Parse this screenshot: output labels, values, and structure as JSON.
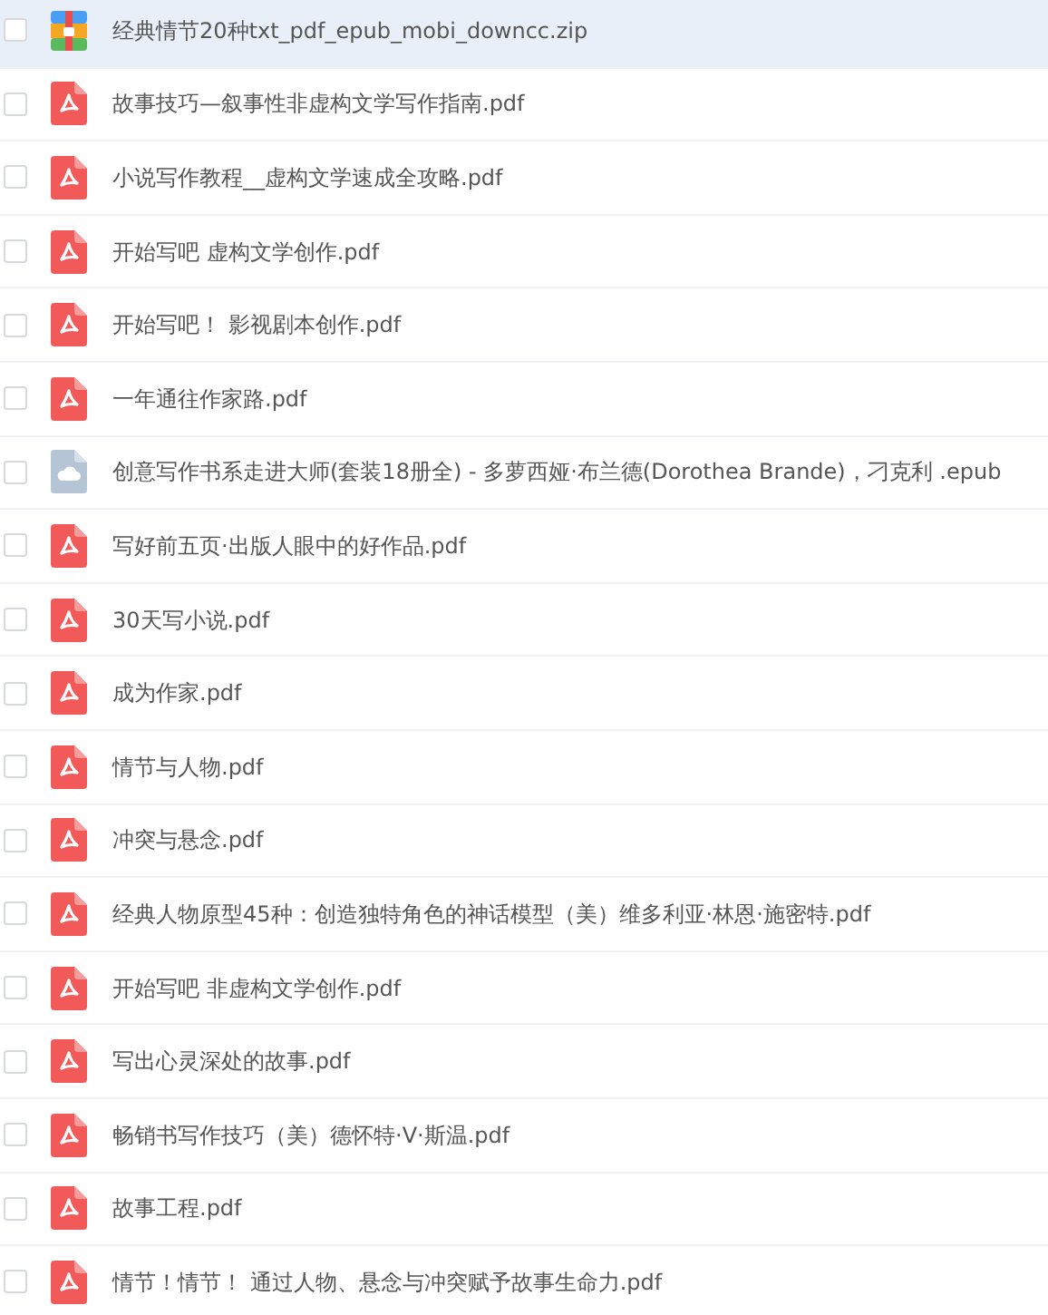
{
  "files": [
    {
      "kind": "zip",
      "name": "经典情节20种txt_pdf_epub_mobi_downcc.zip",
      "selected": true,
      "checked": false
    },
    {
      "kind": "pdf",
      "name": "故事技巧—叙事性非虚构文学写作指南.pdf",
      "selected": false,
      "checked": false
    },
    {
      "kind": "pdf",
      "name": "小说写作教程__虚构文学速成全攻略.pdf",
      "selected": false,
      "checked": false
    },
    {
      "kind": "pdf",
      "name": "开始写吧 虚构文学创作.pdf",
      "selected": false,
      "checked": false
    },
    {
      "kind": "pdf",
      "name": "开始写吧！ 影视剧本创作.pdf",
      "selected": false,
      "checked": false
    },
    {
      "kind": "pdf",
      "name": "一年通往作家路.pdf",
      "selected": false,
      "checked": false
    },
    {
      "kind": "epub",
      "name": "创意写作书系走进大师(套装18册全) - 多萝西娅·布兰德(Dorothea Brande)，刁克利 .epub",
      "selected": false,
      "checked": false
    },
    {
      "kind": "pdf",
      "name": "写好前五页·出版人眼中的好作品.pdf",
      "selected": false,
      "checked": false
    },
    {
      "kind": "pdf",
      "name": "30天写小说.pdf",
      "selected": false,
      "checked": false
    },
    {
      "kind": "pdf",
      "name": "成为作家.pdf",
      "selected": false,
      "checked": false
    },
    {
      "kind": "pdf",
      "name": "情节与人物.pdf",
      "selected": false,
      "checked": false
    },
    {
      "kind": "pdf",
      "name": "冲突与悬念.pdf",
      "selected": false,
      "checked": false
    },
    {
      "kind": "pdf",
      "name": "经典人物原型45种：创造独特角色的神话模型（美）维多利亚·林恩·施密特.pdf",
      "selected": false,
      "checked": false
    },
    {
      "kind": "pdf",
      "name": "开始写吧 非虚构文学创作.pdf",
      "selected": false,
      "checked": false
    },
    {
      "kind": "pdf",
      "name": "写出心灵深处的故事.pdf",
      "selected": false,
      "checked": false
    },
    {
      "kind": "pdf",
      "name": "畅销书写作技巧（美）德怀特·V·斯温.pdf",
      "selected": false,
      "checked": false
    },
    {
      "kind": "pdf",
      "name": "故事工程.pdf",
      "selected": false,
      "checked": false
    },
    {
      "kind": "pdf",
      "name": "情节！情节！ 通过人物、悬念与冲突赋予故事生命力.pdf",
      "selected": false,
      "checked": false
    }
  ]
}
